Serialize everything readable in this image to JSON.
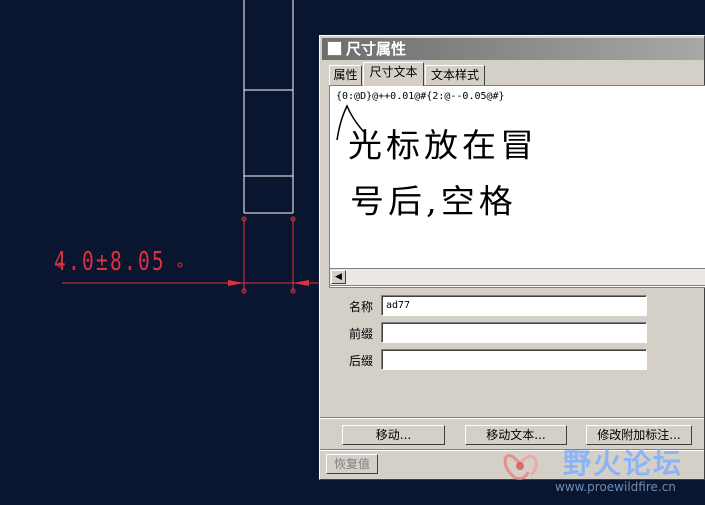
{
  "cad": {
    "dimension_text": "4.0±8.05"
  },
  "dialog": {
    "title": "尺寸属性",
    "tabs": [
      {
        "label": "属性",
        "active": false
      },
      {
        "label": "尺寸文本",
        "active": true
      },
      {
        "label": "文本样式",
        "active": false
      }
    ],
    "dimension_text_code": "{0:@D}@++0.01@#{2:@--0.05@#}",
    "handwritten_note": {
      "line1": "光标放在冒",
      "line2": "号后,空格"
    },
    "fields": [
      {
        "label": "名称",
        "value": "ad77"
      },
      {
        "label": "前缀",
        "value": ""
      },
      {
        "label": "后缀",
        "value": ""
      }
    ],
    "buttons": {
      "move": "移动...",
      "move_text": "移动文本...",
      "modify_note": "修改附加标注...",
      "restore": "恢复值"
    }
  },
  "watermark": {
    "name": "野火论坛",
    "url": "www.proewildfire.cn"
  },
  "colors": {
    "cad_background": "#0a1630",
    "dimension_red": "#e03040",
    "dialog_face": "#d4d0c8"
  }
}
